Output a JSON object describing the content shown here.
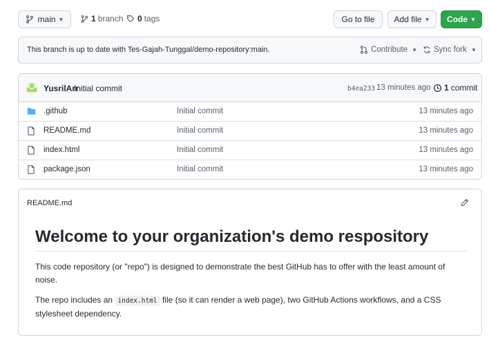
{
  "toolbar": {
    "branch_name": "main",
    "branch_count": "1",
    "branch_label": "branch",
    "tag_count": "0",
    "tag_label": "tags",
    "go_to_file": "Go to file",
    "add_file": "Add file",
    "code": "Code",
    "code_button_color": "#2da44e"
  },
  "sync": {
    "message": "This branch is up to date with Tes-Gajah-Tunggal/demo-repository:main.",
    "contribute": "Contribute",
    "sync_fork": "Sync fork"
  },
  "commit": {
    "author": "YusrilArr",
    "message": "Initial commit",
    "sha": "b4ea233",
    "time": "13 minutes ago",
    "count": "1",
    "count_label": "commit"
  },
  "files": [
    {
      "name": ".github",
      "type": "folder",
      "icon": "folder-icon",
      "message": "Initial commit",
      "time": "13 minutes ago"
    },
    {
      "name": "README.md",
      "type": "file",
      "icon": "file-icon",
      "message": "Initial commit",
      "time": "13 minutes ago"
    },
    {
      "name": "index.html",
      "type": "file",
      "icon": "file-icon",
      "message": "Initial commit",
      "time": "13 minutes ago"
    },
    {
      "name": "package.json",
      "type": "file",
      "icon": "file-icon",
      "message": "Initial commit",
      "time": "13 minutes ago"
    }
  ],
  "readme": {
    "filename": "README.md",
    "heading": "Welcome to your organization's demo respository",
    "para1": "This code repository (or \"repo\") is designed to demonstrate the best GitHub has to offer with the least amount of noise.",
    "para2_before": "The repo includes an ",
    "para2_code": "index.html",
    "para2_after": " file (so it can render a web page), two GitHub Actions workflows, and a CSS stylesheet dependency."
  },
  "colors": {
    "folder": "#54aeff",
    "border": "#d0d7de",
    "muted": "#57606a"
  }
}
